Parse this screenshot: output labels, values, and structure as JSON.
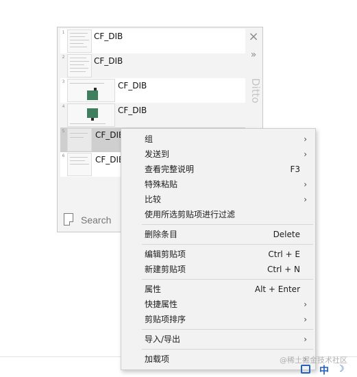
{
  "ditto": {
    "close_label": "×",
    "more_label": "»",
    "brand": "Ditto",
    "search_placeholder": "Search",
    "clips": [
      {
        "num": "1",
        "text": "CF_DIB"
      },
      {
        "num": "2",
        "text": "CF_DIB"
      },
      {
        "num": "3",
        "text": "CF_DIB"
      },
      {
        "num": "4",
        "text": "CF_DIB"
      },
      {
        "num": "5",
        "text": "CF_DIB"
      },
      {
        "num": "6",
        "text": "CF_DIB"
      }
    ]
  },
  "context_menu": {
    "items": [
      {
        "label": "组",
        "shortcut": "",
        "submenu": "›"
      },
      {
        "label": "发送到",
        "shortcut": "",
        "submenu": "›"
      },
      {
        "label": "查看完整说明",
        "shortcut": "F3",
        "submenu": ""
      },
      {
        "label": "特殊粘贴",
        "shortcut": "",
        "submenu": "›"
      },
      {
        "label": "比较",
        "shortcut": "",
        "submenu": "›"
      },
      {
        "label": "使用所选剪贴项进行过滤",
        "shortcut": "",
        "submenu": ""
      },
      {
        "label": "删除条目",
        "shortcut": "Delete",
        "submenu": ""
      },
      {
        "label": "编辑剪贴项",
        "shortcut": "Ctrl + E",
        "submenu": ""
      },
      {
        "label": "新建剪贴项",
        "shortcut": "Ctrl + N",
        "submenu": ""
      },
      {
        "label": "属性",
        "shortcut": "Alt + Enter",
        "submenu": ""
      },
      {
        "label": "快捷属性",
        "shortcut": "",
        "submenu": "›"
      },
      {
        "label": "剪贴项排序",
        "shortcut": "",
        "submenu": "›"
      },
      {
        "label": "导入/导出",
        "shortcut": "",
        "submenu": "›"
      },
      {
        "label": "加载项",
        "shortcut": "",
        "submenu": "›"
      }
    ]
  },
  "taskbar": {
    "watermark": "@稀土掘金技术社区",
    "ime_label": "中",
    "moon_icon": "☽"
  }
}
